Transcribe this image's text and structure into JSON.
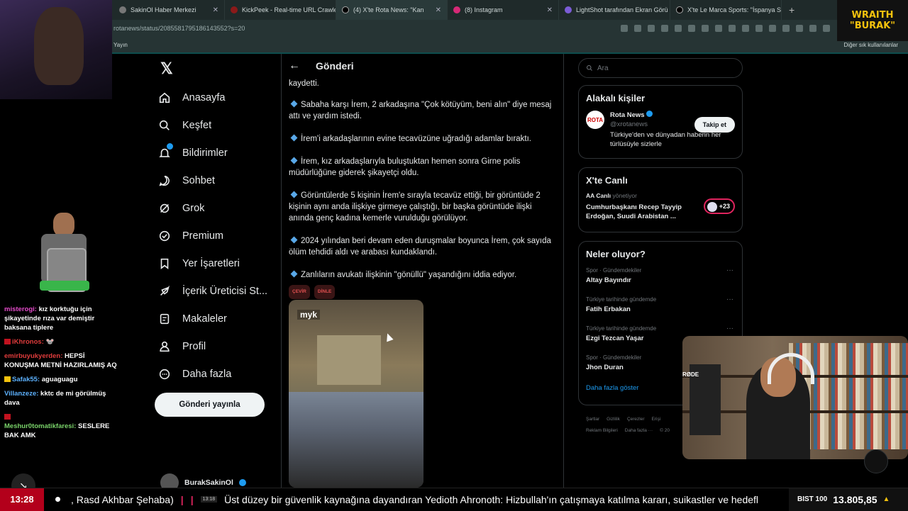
{
  "browser": {
    "tabs": [
      {
        "title": "SakinOl Haber Merkezi"
      },
      {
        "title": "KickPeek - Real-time URL Crawler"
      },
      {
        "title": "(4) X'te Rota News: \"Kan"
      },
      {
        "title": "(8) Instagram"
      },
      {
        "title": "LightShot tarafından Ekran Görü"
      },
      {
        "title": "X'te Le Marca Sports: \"İspanya S"
      }
    ],
    "url": "rotanews/status/2085581795186143552?s=20",
    "bookmark": "Yayın",
    "bookmarks_right": "Diğer sık kullanılanlar"
  },
  "overlay_badge": {
    "line1": "WRAITH",
    "line2": "\"BURAK\""
  },
  "chat": [
    {
      "user": "misterogi:",
      "text": "kız korktuğu için şikayetinde rıza var demiştir baksana tiplere"
    },
    {
      "user": "iKhronos:",
      "text": "🐭"
    },
    {
      "user": "emirbuyukyerden:",
      "text": "HEPSİ KONUŞMA METNİ HAZIRLAMIŞ AQ"
    },
    {
      "user": "Safak55:",
      "text": "aguaguagu"
    },
    {
      "user": "Villanzeze:",
      "text": "kktc de mi görülmüş dava"
    },
    {
      "user": "Meshur0tomatikfaresi:",
      "text": "SESLERE BAK AMK"
    }
  ],
  "nav": {
    "items": [
      {
        "label": "Anasayfa"
      },
      {
        "label": "Keşfet"
      },
      {
        "label": "Bildirimler"
      },
      {
        "label": "Sohbet"
      },
      {
        "label": "Grok"
      },
      {
        "label": "Premium"
      },
      {
        "label": "Yer İşaretleri"
      },
      {
        "label": "İçerik Üreticisi St..."
      },
      {
        "label": "Makaleler"
      },
      {
        "label": "Profil"
      },
      {
        "label": "Daha fazla"
      }
    ],
    "post_button": "Gönderi yayınla",
    "user_name": "BurakSakinOl"
  },
  "post": {
    "header": "Gönderi",
    "intro": "kaydetti.",
    "bullets": [
      "Sabaha karşı İrem, 2 arkadaşına \"Çok kötüyüm, beni alın\" diye mesaj attı ve yardım istedi.",
      "İrem'i arkadaşlarının evine tecavüzüne uğradığı adamlar bıraktı.",
      "İrem, kız arkadaşlarıyla buluştuktan hemen sonra Girne polis müdürlüğüne giderek şikayetçi oldu.",
      "Görüntülerde 5 kişinin İrem'e sırayla tecavüz ettiği, bir görüntüde 2 kişinin aynı anda ilişkiye girmeye çalıştığı, bir başka görüntüde ilişki anında genç kadına kemerle vurulduğu görülüyor.",
      "2024 yılından beri devam eden duruşmalar boyunca İrem, çok sayıda ölüm tehdidi aldı ve arabası kundaklandı.",
      "Zanlıların avukatı ilişkinin \"gönüllü\" yaşandığını iddia ediyor."
    ],
    "pill_translate": "ÇEVİR",
    "pill_listen": "DİNLE",
    "media_watermark": "myk"
  },
  "right": {
    "search_placeholder": "Ara",
    "related_title": "Alakalı kişiler",
    "related": {
      "name": "Rota News",
      "handle": "@xrotanews",
      "bio": "Türkiye'den ve dünyadan haberin her türlüsüyle sizlerle",
      "follow": "Takip et",
      "logo": "ROTA"
    },
    "live_title": "X'te Canlı",
    "live": {
      "source": "AA Canlı",
      "role": "yönetiyor",
      "title": "Cumhurbaşkanı Recep Tayyip Erdoğan, Suudi Arabistan ...",
      "count": "+23"
    },
    "trends_title": "Neler oluyor?",
    "trends": [
      {
        "context": "Spor · Gündemdekiler",
        "name": "Altay Bayındır"
      },
      {
        "context": "Türkiye tarihinde gündemde",
        "name": "Fatih Erbakan"
      },
      {
        "context": "Türkiye tarihinde gündemde",
        "name": "Ezgi Tezcan Yaşar"
      },
      {
        "context": "Spor · Gündemdekiler",
        "name": "Jhon Duran"
      }
    ],
    "show_more": "Daha fazla göster",
    "footer": [
      "Şartlar",
      "Gizlilik",
      "Çerezler",
      "Erişi",
      "Reklam Bilgileri",
      "Daha fazla ···",
      "© 20"
    ]
  },
  "cam2": {
    "mic_label": "RØDE"
  },
  "ticker": {
    "clock": "13:28",
    "headline_prefix": ", Rasd Akhbar Şehaba)",
    "time": "13:18",
    "headline": "Üst düzey bir güvenlik kaynağına dayandıran Yedioth Ahronoth: Hizbullah'ın çatışmaya katılma kararı, suikastler ve hedefl",
    "index_label": "BIST 100",
    "index_value": "13.805,85"
  },
  "colors": {
    "accent": "#1d9bf0",
    "live_red": "#e0245e",
    "clock_red": "#b3001b",
    "badge_yellow": "#f4c20d"
  }
}
